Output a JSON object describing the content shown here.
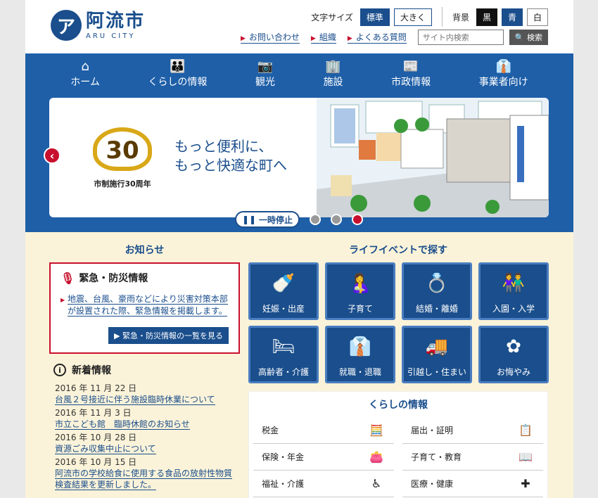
{
  "brand": {
    "name": "阿流市",
    "subtitle": "ARU CITY",
    "mark": "ア"
  },
  "tools": {
    "font_size_label": "文字サイズ",
    "font_normal": "標準",
    "font_large": "大きく",
    "bg_label": "背景",
    "bg_black": "黒",
    "bg_blue": "青",
    "bg_white": "白"
  },
  "links": {
    "contact": "お問い合わせ",
    "org": "組織",
    "faq": "よくある質問"
  },
  "search": {
    "placeholder": "サイト内検索",
    "button": "検索"
  },
  "nav": [
    {
      "label": "ホーム",
      "icon": "home-icon",
      "glyph": "⌂"
    },
    {
      "label": "くらしの情報",
      "icon": "family-icon",
      "glyph": "👪"
    },
    {
      "label": "観光",
      "icon": "camera-icon",
      "glyph": "📷"
    },
    {
      "label": "施設",
      "icon": "building-icon",
      "glyph": "🏢"
    },
    {
      "label": "市政情報",
      "icon": "newspaper-icon",
      "glyph": "📰"
    },
    {
      "label": "事業者向け",
      "icon": "presenter-icon",
      "glyph": "👔"
    }
  ],
  "hero": {
    "badge_number": "30",
    "badge_caption": "市制施行30周年",
    "tagline_1": "もっと便利に、",
    "tagline_2": "もっと快適な町へ",
    "pause_label": "一時停止",
    "prev_glyph": "‹"
  },
  "news": {
    "section_title": "お知らせ",
    "emergency_title": "緊急・防災情報",
    "emergency_body": "地震、台風、豪雨などにより災害対策本部が設置された際、緊急情報を掲載します。",
    "emergency_button": "▶ 緊急・防災情報の一覧を見る",
    "new_title": "新着情報",
    "items": [
      {
        "date": "2016 年 11 月 22 日",
        "title": "台風２号接近に伴う施設臨時休業について"
      },
      {
        "date": "2016 年 11 月 3 日",
        "title": "市立こども館　臨時休館のお知らせ"
      },
      {
        "date": "2016 年 10 月 28 日",
        "title": "資源ごみ収集中止について"
      },
      {
        "date": "2016 年 10 月 15 日",
        "title": "阿流市の学校給食に使用する食品の放射性物質検査結果を更新しました。"
      }
    ]
  },
  "lifeevents": {
    "title": "ライフイベントで探す",
    "items": [
      {
        "label": "妊娠・出産",
        "icon": "baby-bottle-icon",
        "glyph": "🍼"
      },
      {
        "label": "子育て",
        "icon": "parenting-icon",
        "glyph": "🤱"
      },
      {
        "label": "結婚・離婚",
        "icon": "ring-icon",
        "glyph": "💍"
      },
      {
        "label": "入園・入学",
        "icon": "children-icon",
        "glyph": "👫"
      },
      {
        "label": "高齢者・介護",
        "icon": "elderly-care-icon",
        "glyph": "🛏"
      },
      {
        "label": "就職・退職",
        "icon": "necktie-icon",
        "glyph": "👔"
      },
      {
        "label": "引越し・住まい",
        "icon": "moving-truck-icon",
        "glyph": "🚚"
      },
      {
        "label": "お悔やみ",
        "icon": "chrysanthemum-icon",
        "glyph": "✿"
      }
    ]
  },
  "living": {
    "title": "くらしの情報",
    "items": [
      {
        "label": "税金",
        "icon": "calculator-icon",
        "glyph": "🧮"
      },
      {
        "label": "届出・証明",
        "icon": "certificate-icon",
        "glyph": "📋"
      },
      {
        "label": "保険・年金",
        "icon": "wallet-icon",
        "glyph": "👛"
      },
      {
        "label": "子育て・教育",
        "icon": "book-icon",
        "glyph": "📖"
      },
      {
        "label": "福祉・介護",
        "icon": "wheelchair-icon",
        "glyph": "♿"
      },
      {
        "label": "医療・健康",
        "icon": "medical-kit-icon",
        "glyph": "✚"
      }
    ]
  },
  "colors": {
    "brand": "#1a4e8c",
    "accent": "#c8102e",
    "band": "#1e5fa8",
    "cream": "#fbf3d9"
  }
}
